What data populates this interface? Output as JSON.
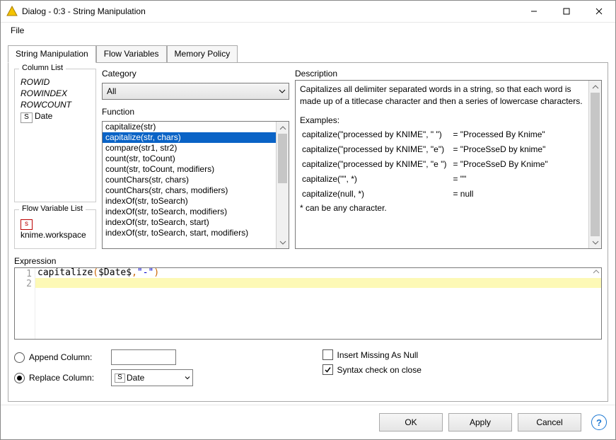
{
  "window": {
    "title": "Dialog - 0:3 - String Manipulation"
  },
  "menu": {
    "file": "File"
  },
  "tabs": {
    "t1": "String Manipulation",
    "t2": "Flow Variables",
    "t3": "Memory Policy"
  },
  "panels": {
    "columnList": {
      "title": "Column List",
      "rowid": "ROWID",
      "rowindex": "ROWINDEX",
      "rowcount": "ROWCOUNT",
      "dateIcon": "S",
      "dateLabel": "Date"
    },
    "flowVarList": {
      "title": "Flow Variable List",
      "wsIcon": "s",
      "wsLabel": "knime.workspace"
    }
  },
  "category": {
    "label": "Category",
    "value": "All"
  },
  "function": {
    "label": "Function",
    "selectedIndex": 1,
    "items": [
      "capitalize(str)",
      "capitalize(str, chars)",
      "compare(str1, str2)",
      "count(str, toCount)",
      "count(str, toCount, modifiers)",
      "countChars(str, chars)",
      "countChars(str, chars, modifiers)",
      "indexOf(str, toSearch)",
      "indexOf(str, toSearch, modifiers)",
      "indexOf(str, toSearch, start)",
      "indexOf(str, toSearch, start, modifiers)"
    ]
  },
  "description": {
    "label": "Description",
    "intro": "Capitalizes all delimiter separated words in a string, so that each word is made up of a titlecase character and then a series of lowercase characters.",
    "examplesLabel": "Examples:",
    "rows": [
      {
        "l": "capitalize(\"processed by KNIME\", \" \")",
        "r": "= \"Processed By Knime\""
      },
      {
        "l": "capitalize(\"processed by KNIME\", \"e\")",
        "r": "= \"ProceSseD by knime\""
      },
      {
        "l": "capitalize(\"processed by KNIME\", \"e \")",
        "r": "= \"ProceSseD By Knime\""
      },
      {
        "l": "capitalize(\"\", *)",
        "r": "= \"\""
      },
      {
        "l": "capitalize(null, *)",
        "r": "= null"
      }
    ],
    "note": "* can be any character."
  },
  "expression": {
    "label": "Expression",
    "line1_a": "capitalize",
    "line1_b": "(",
    "line1_c": "$Date$",
    "line1_d": ",",
    "line1_e": "\"-\"",
    "line1_f": ")",
    "g1": "1",
    "g2": "2"
  },
  "options": {
    "appendLabel": "Append Column:",
    "replaceLabel": "Replace Column:",
    "replaceIcon": "S",
    "replaceValue": "Date",
    "insertMissing": "Insert Missing As Null",
    "syntaxCheck": "Syntax check on close"
  },
  "buttons": {
    "ok": "OK",
    "apply": "Apply",
    "cancel": "Cancel"
  },
  "colors": {
    "select": "#0a63c6"
  }
}
